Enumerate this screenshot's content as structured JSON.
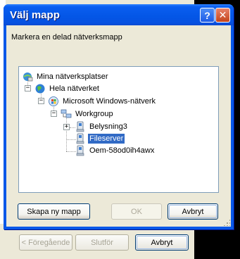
{
  "background_wizard": {
    "back_label": "< Föregående",
    "finish_label": "Slutför",
    "cancel_label": "Avbryt"
  },
  "dialog": {
    "title": "Välj mapp",
    "help_symbol": "?",
    "close_symbol": "✕",
    "instruction": "Markera en delad nätverksmapp",
    "tree": [
      {
        "label": "Mina nätverksplatser",
        "icon": "network-places-icon"
      },
      {
        "label": "Hela nätverket",
        "icon": "entire-network-icon",
        "expander": "−"
      },
      {
        "label": "Microsoft Windows-nätverk",
        "icon": "windows-network-icon",
        "expander": "−"
      },
      {
        "label": "Workgroup",
        "icon": "workgroup-icon",
        "expander": "−"
      },
      {
        "label": "Belysning3",
        "icon": "computer-icon",
        "expander": "+"
      },
      {
        "label": "Fileserver",
        "icon": "computer-icon",
        "selected": true
      },
      {
        "label": "Oem-58od0ih4awx",
        "icon": "computer-icon"
      }
    ],
    "buttons": {
      "new_folder": "Skapa ny mapp",
      "ok": "OK",
      "cancel": "Avbryt"
    }
  },
  "colors": {
    "title_blue": "#0456e6",
    "selection": "#316ac5",
    "face": "#ece9d8"
  }
}
